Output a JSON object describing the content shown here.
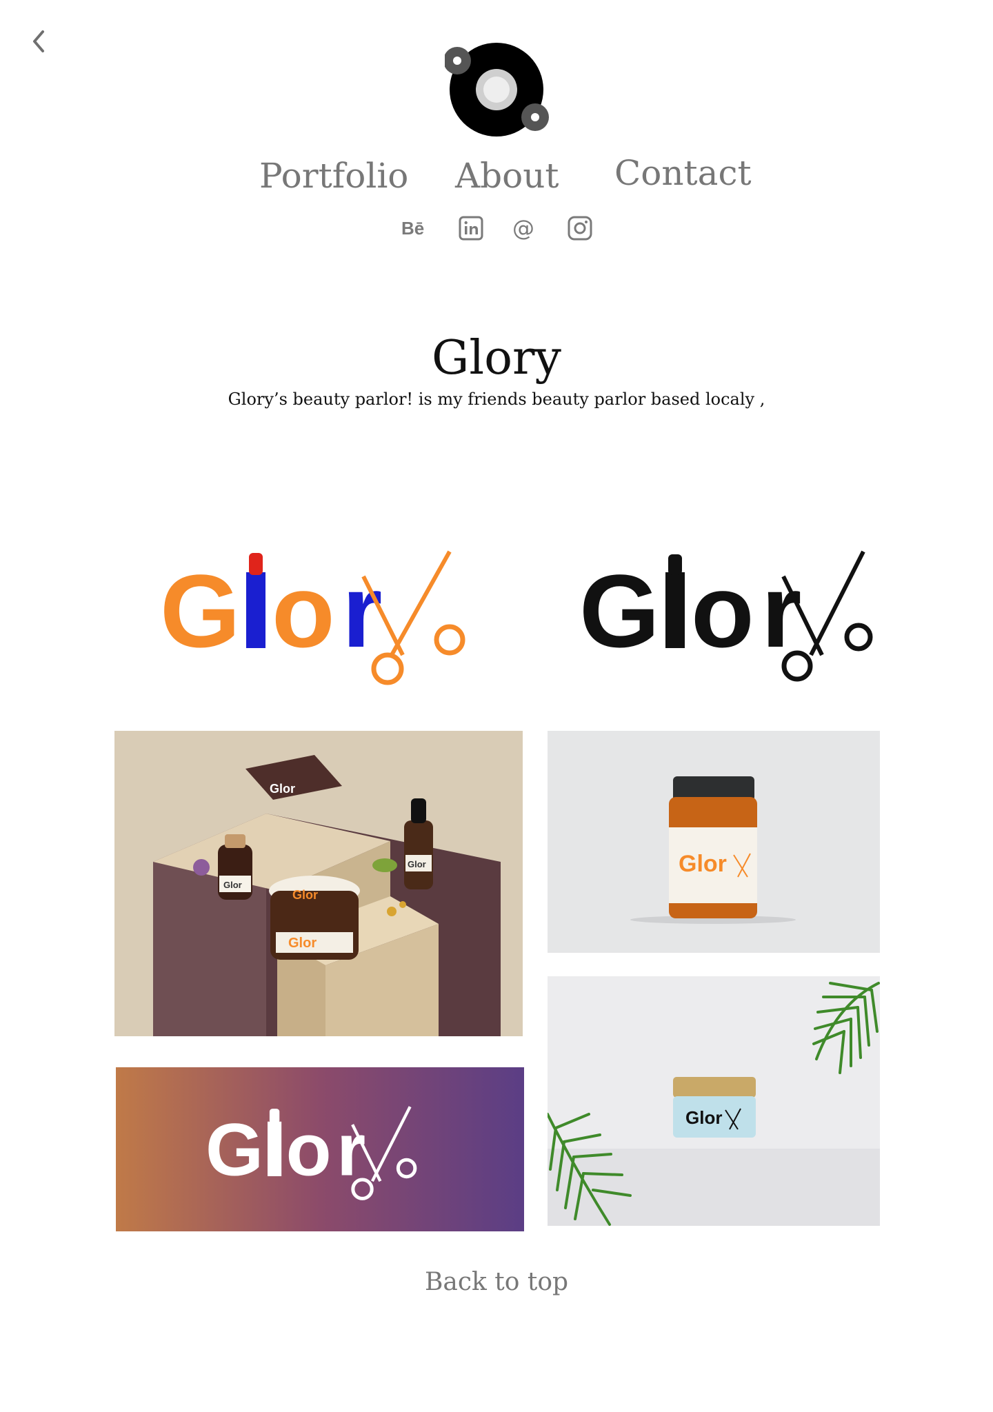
{
  "nav": {
    "items": [
      {
        "label": "Portfolio"
      },
      {
        "label": "About"
      },
      {
        "label": "Contact"
      }
    ],
    "back_icon": "chevron-left-icon",
    "social_icons": [
      "behance-icon",
      "linkedin-icon",
      "email-icon",
      "instagram-icon"
    ]
  },
  "project": {
    "title": "Glory",
    "description": "Glory’s beauty parlor! is my friends beauty parlor based localy ,"
  },
  "brand": {
    "logo_text": "Glor",
    "colors": {
      "orange": "#F68B2A",
      "blue": "#1A1FD0",
      "red": "#E0241B",
      "black": "#111111",
      "gradient_start": "#C07A48",
      "gradient_mid": "#8C4B6A",
      "gradient_end": "#5B3E85"
    }
  },
  "footer": {
    "back_to_top": "Back to top"
  }
}
